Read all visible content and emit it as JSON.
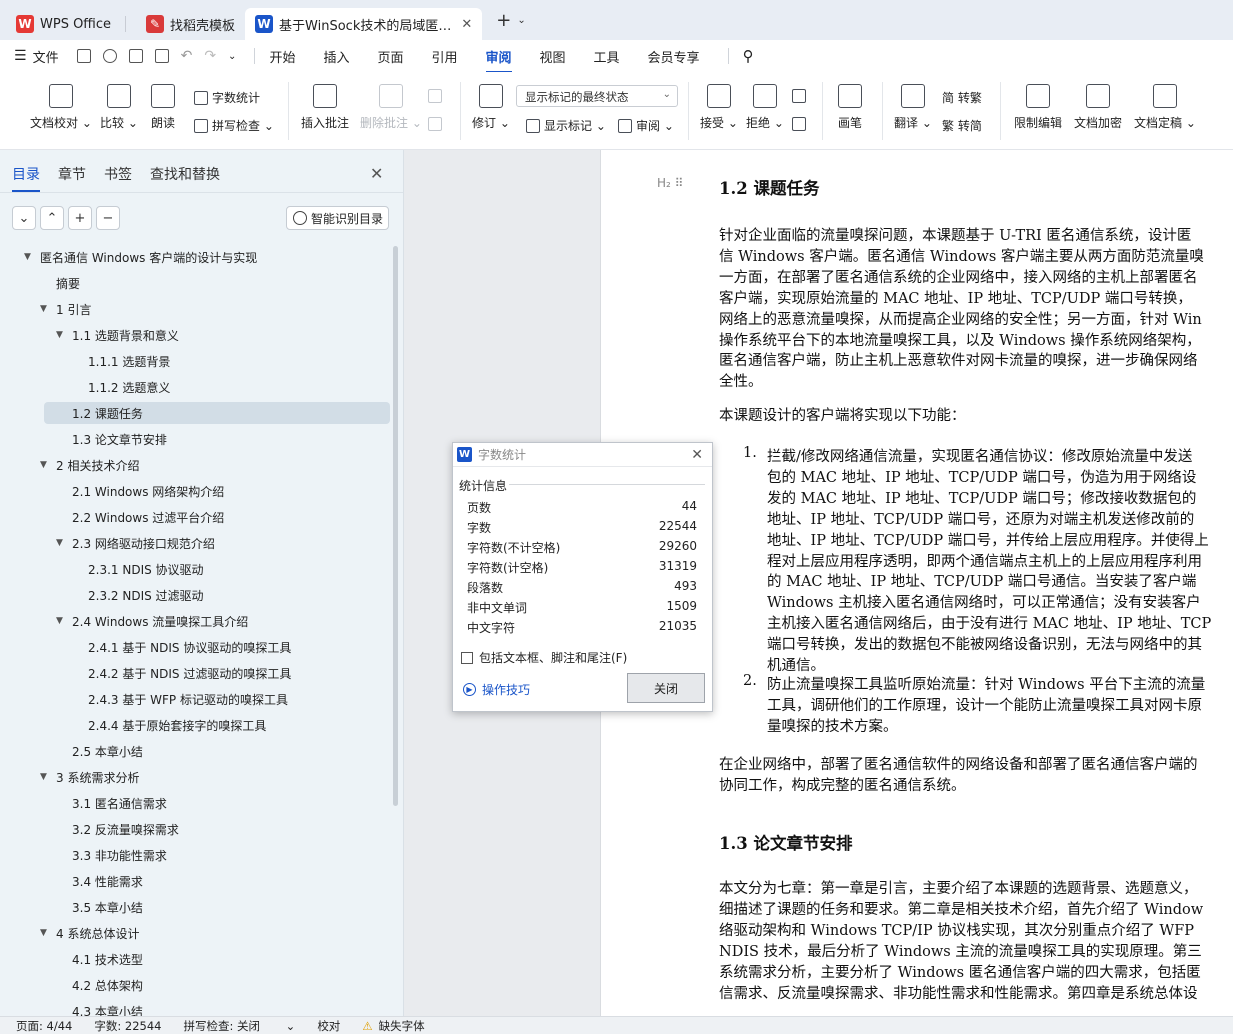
{
  "tabs": [
    {
      "label": "WPS Office",
      "active": false
    },
    {
      "label": "找稻壳模板",
      "active": false
    },
    {
      "label": "基于WinSock技术的局域匿…",
      "active": true
    }
  ],
  "menu": {
    "file": "文件",
    "items": [
      "开始",
      "插入",
      "页面",
      "引用",
      "审阅",
      "视图",
      "工具",
      "会员专享"
    ],
    "active": "审阅"
  },
  "ribbon": {
    "doc_check": "文档校对",
    "compare": "比较",
    "read_aloud": "朗读",
    "word_count": "字数统计",
    "spell_check": "拼写检查",
    "insert_comment": "插入批注",
    "delete_comment": "删除批注",
    "revise": "修订",
    "markup_state": "显示标记的最终状态",
    "show_markup": "显示标记",
    "review": "审阅",
    "accept": "接受",
    "reject": "拒绝",
    "pen": "画笔",
    "translate": "翻译",
    "to_traditional": "简 转繁",
    "to_simplified": "繁 转简",
    "restrict_edit": "限制编辑",
    "doc_encrypt": "文档加密",
    "doc_finalize": "文档定稿"
  },
  "nav": {
    "tabs": [
      "目录",
      "章节",
      "书签",
      "查找和替换"
    ],
    "active_tab": "目录",
    "smart_toc": "智能识别目录",
    "items": [
      {
        "label": "匿名通信 Windows 客户端的设计与实现",
        "level": 0,
        "expand": true
      },
      {
        "label": "摘要",
        "level": 1,
        "expand": false
      },
      {
        "label": "1  引言",
        "level": 1,
        "expand": true
      },
      {
        "label": "1.1  选题背景和意义",
        "level": 2,
        "expand": true
      },
      {
        "label": "1.1.1  选题背景",
        "level": 3,
        "expand": false
      },
      {
        "label": "1.1.2  选题意义",
        "level": 3,
        "expand": false
      },
      {
        "label": "1.2  课题任务",
        "level": 2,
        "expand": false,
        "selected": true
      },
      {
        "label": "1.3  论文章节安排",
        "level": 2,
        "expand": false
      },
      {
        "label": "2  相关技术介绍",
        "level": 1,
        "expand": true
      },
      {
        "label": "2.1 Windows  网络架构介绍",
        "level": 2,
        "expand": false
      },
      {
        "label": "2.2 Windows  过滤平台介绍",
        "level": 2,
        "expand": false
      },
      {
        "label": "2.3  网络驱动接口规范介绍",
        "level": 2,
        "expand": true
      },
      {
        "label": "2.3.1 NDIS  协议驱动",
        "level": 3,
        "expand": false
      },
      {
        "label": "2.3.2 NDIS  过滤驱动",
        "level": 3,
        "expand": false
      },
      {
        "label": "2.4 Windows  流量嗅探工具介绍",
        "level": 2,
        "expand": true
      },
      {
        "label": "2.4.1  基于  NDIS  协议驱动的嗅探工具",
        "level": 3,
        "expand": false
      },
      {
        "label": "2.4.2  基于  NDIS  过滤驱动的嗅探工具",
        "level": 3,
        "expand": false
      },
      {
        "label": "2.4.3  基于  WFP  标记驱动的嗅探工具",
        "level": 3,
        "expand": false
      },
      {
        "label": "2.4.4  基于原始套接字的嗅探工具",
        "level": 3,
        "expand": false
      },
      {
        "label": "2.5  本章小结",
        "level": 2,
        "expand": false
      },
      {
        "label": "3  系统需求分析",
        "level": 1,
        "expand": true
      },
      {
        "label": "3.1  匿名通信需求",
        "level": 2,
        "expand": false
      },
      {
        "label": "3.2  反流量嗅探需求",
        "level": 2,
        "expand": false
      },
      {
        "label": "3.3  非功能性需求",
        "level": 2,
        "expand": false
      },
      {
        "label": "3.4  性能需求",
        "level": 2,
        "expand": false
      },
      {
        "label": "3.5  本章小结",
        "level": 2,
        "expand": false
      },
      {
        "label": "4  系统总体设计",
        "level": 1,
        "expand": true
      },
      {
        "label": "4.1  技术选型",
        "level": 2,
        "expand": false
      },
      {
        "label": "4.2  总体架构",
        "level": 2,
        "expand": false
      },
      {
        "label": "4.3  本章小结",
        "level": 2,
        "expand": false
      }
    ]
  },
  "document": {
    "h_marker": "H₂",
    "heading1": "1.2  课题任务",
    "para1": [
      "针对企业面临的流量嗅探问题，本课题基于  U-TRI  匿名通信系统，设计匿",
      "信  Windows  客户端。匿名通信  Windows  客户端主要从两方面防范流量嗅",
      "一方面，在部署了匿名通信系统的企业网络中，接入网络的主机上部署匿名",
      "客户端，实现原始流量的  MAC  地址、IP  地址、TCP/UDP  端口号转换，",
      "网络上的恶意流量嗅探，从而提高企业网络的安全性；另一方面，针对  Win",
      "操作系统平台下的本地流量嗅探工具，以及  Windows  操作系统网络架构，",
      "匿名通信客户端，防止主机上恶意软件对网卡流量的嗅探，进一步确保网络",
      "全性。"
    ],
    "para2": "本课题设计的客户端将实现以下功能：",
    "list1_num": "1.",
    "list1": [
      "拦截/修改网络通信流量，实现匿名通信协议：修改原始流量中发送",
      "包的  MAC  地址、IP  地址、TCP/UDP  端口号，伪造为用于网络设",
      "发的  MAC  地址、IP  地址、TCP/UDP  端口号；修改接收数据包的",
      "地址、IP  地址、TCP/UDP  端口号，还原为对端主机发送修改前的",
      "地址、IP  地址、TCP/UDP  端口号，并传给上层应用程序。并使得上",
      "程对上层应用程序透明，即两个通信端点主机上的上层应用程序利用",
      "的  MAC  地址、IP  地址、TCP/UDP  端口号通信。当安装了客户端",
      "Windows  主机接入匿名通信网络时，可以正常通信；没有安装客户",
      "主机接入匿名通信网络后，由于没有进行  MAC  地址、IP  地址、TCP",
      "端口号转换，发出的数据包不能被网络设备识别，无法与网络中的其",
      "机通信。"
    ],
    "list2_num": "2.",
    "list2": [
      "防止流量嗅探工具监听原始流量：针对  Windows  平台下主流的流量",
      "工具，调研他们的工作原理，设计一个能防止流量嗅探工具对网卡原",
      "量嗅探的技术方案。"
    ],
    "para3": [
      "在企业网络中，部署了匿名通信软件的网络设备和部署了匿名通信客户端的",
      "协同工作，构成完整的匿名通信系统。"
    ],
    "heading2": "1.3  论文章节安排",
    "para4": [
      "本文分为七章：第一章是引言，主要介绍了本课题的选题背景、选题意义，",
      "细描述了课题的任务和要求。第二章是相关技术介绍，首先介绍了  Window",
      "络驱动架构和  Windows TCP/IP  协议栈实现，其次分别重点介绍了  WFP  ",
      "NDIS  技术，最后分析了  Windows  主流的流量嗅探工具的实现原理。第三",
      "系统需求分析，主要分析了  Windows  匿名通信客户端的四大需求，包括匿",
      "信需求、反流量嗅探需求、非功能性需求和性能需求。第四章是系统总体设"
    ]
  },
  "dialog": {
    "title": "字数统计",
    "section": "统计信息",
    "stats": [
      {
        "label": "页数",
        "value": "44"
      },
      {
        "label": "字数",
        "value": "22544"
      },
      {
        "label": "字符数(不计空格)",
        "value": "29260"
      },
      {
        "label": "字符数(计空格)",
        "value": "31319"
      },
      {
        "label": "段落数",
        "value": "493"
      },
      {
        "label": "非中文单词",
        "value": "1509"
      },
      {
        "label": "中文字符",
        "value": "21035"
      }
    ],
    "checkbox": "包括文本框、脚注和尾注(F)",
    "checked": false,
    "tips": "操作技巧",
    "close_btn": "关闭"
  },
  "status": {
    "page": "页面: 4/44",
    "words": "字数: 22544",
    "spell": "拼写检查: 关闭",
    "proof": "校对",
    "missing_font": "缺失字体"
  },
  "colors": {
    "accent": "#1a55c9",
    "wps_red": "#e53935",
    "template_red": "#d93a3a"
  }
}
